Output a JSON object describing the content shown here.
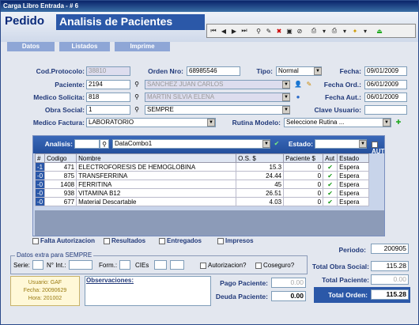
{
  "window": {
    "title": "Carga Libro Entrada - # 6"
  },
  "header": {
    "pedido": "Pedido",
    "title": "Analisis de Pacientes"
  },
  "tabs": [
    "Datos",
    "Listados",
    "Imprime"
  ],
  "form": {
    "cod_protocolo_label": "Cod.Protocolo:",
    "cod_protocolo": "38810",
    "orden_nro_label": "Orden Nro:",
    "orden_nro": "68985546",
    "tipo_label": "Tipo:",
    "tipo": "Normal",
    "fecha_label": "Fecha:",
    "fecha": "09/01/2009",
    "paciente_label": "Paciente:",
    "paciente_code": "2194",
    "paciente_name": "SANCHEZ JUAN CARLOS",
    "fecha_ord_label": "Fecha Ord.:",
    "fecha_ord": "06/01/2009",
    "medico_solicita_label": "Medico Solicita:",
    "medico_code": "818",
    "medico_name": "MARTIN SILVIA ELENA",
    "fecha_aut_label": "Fecha Aut.:",
    "fecha_aut": "06/01/2009",
    "obra_social_label": "Obra Social:",
    "obra_code": "1",
    "obra_name": "SEMPRE",
    "clave_usuario_label": "Clave Usuario:",
    "clave_usuario": "",
    "medico_factura_label": "Medico Factura:",
    "medico_factura": "LABORATORIO",
    "rutina_label": "Rutina Modelo:",
    "rutina": "Seleccione Rutina ..."
  },
  "grid": {
    "analisis_label": "Analisis:",
    "analisis_code": "",
    "datacombo": "DataCombo1",
    "estado_label": "Estado:",
    "estado": "",
    "aut_label": "AUT",
    "columns": [
      "#",
      "Codigo",
      "Nombre",
      "O.S. $",
      "Paciente $",
      "Aut",
      "Estado"
    ],
    "rows": [
      {
        "mark": "-1",
        "codigo": "471",
        "nombre": "ELECTROFORESIS DE HEMOGLOBINA",
        "os": "15.3",
        "pac": "0",
        "aut": "✔",
        "estado": "Espera"
      },
      {
        "mark": "-0",
        "codigo": "875",
        "nombre": "TRANSFERRINA",
        "os": "24.44",
        "pac": "0",
        "aut": "✔",
        "estado": "Espera"
      },
      {
        "mark": "-0",
        "codigo": "1408",
        "nombre": "FERRITINA",
        "os": "45",
        "pac": "0",
        "aut": "✔",
        "estado": "Espera"
      },
      {
        "mark": "-0",
        "codigo": "938",
        "nombre": "VITAMINA B12",
        "os": "26.51",
        "pac": "0",
        "aut": "✔",
        "estado": "Espera"
      },
      {
        "mark": "-0",
        "codigo": "677",
        "nombre": "Material Descartable",
        "os": "4.03",
        "pac": "0",
        "aut": "✔",
        "estado": "Espera"
      }
    ]
  },
  "filters": {
    "falta": "Falta Autorizacion",
    "resultados": "Resultados",
    "entregados": "Entregados",
    "impresos": "Impresos"
  },
  "extra": {
    "legend": "Datos extra para SEMPRE",
    "serie_label": "Serie:",
    "nint_label": "N° Int.:",
    "form_label": "Form.:",
    "cies_label": "CIEs",
    "autorizacion": "Autorizacion?",
    "coseguro": "Coseguro?"
  },
  "user_box": {
    "usuario": "Usuario: GAF",
    "fecha": "Fecha: 20090629",
    "hora": "Hora: 201002"
  },
  "obs_label": "Observaciones:",
  "pago": {
    "label": "Pago Paciente:",
    "value": "0.00"
  },
  "deuda": {
    "label": "Deuda Paciente:",
    "value": "0.00"
  },
  "periodo": {
    "label": "Periodo:",
    "value": "200905"
  },
  "total_os": {
    "label": "Total Obra Social:",
    "value": "115.28"
  },
  "total_pac": {
    "label": "Total Paciente:",
    "value": "0.00"
  },
  "total_orden": {
    "label": "Total Orden:",
    "value": "115.28"
  }
}
